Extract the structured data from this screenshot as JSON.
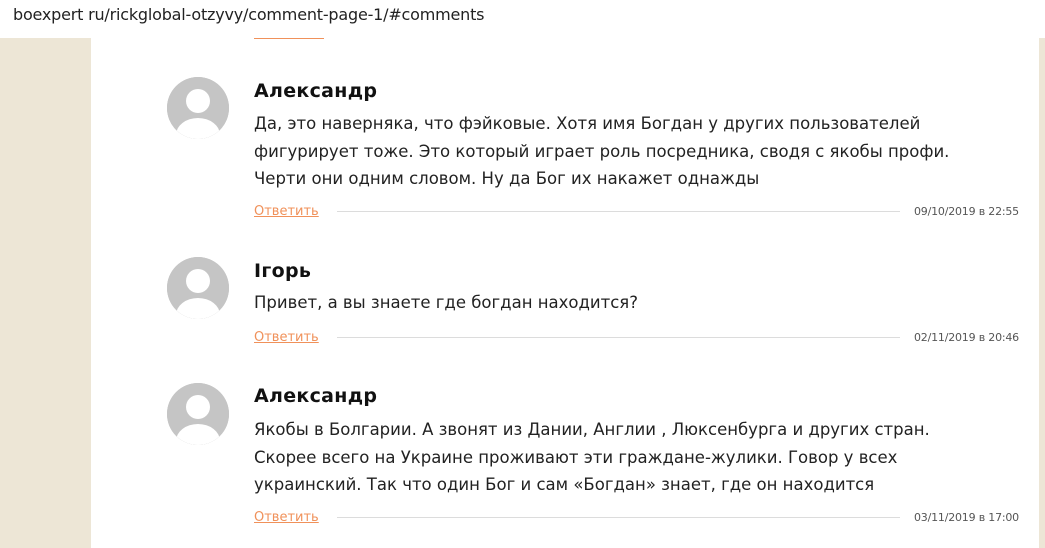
{
  "browser": {
    "url": "boexpert ru/rickglobal-otzyvy/comment-page-1/#comments"
  },
  "comments": [
    {
      "author": "Александр",
      "lines": [
        "Да, это наверняка, что фэйковые. Хотя имя Богдан у других пользователей",
        "фигурирует тоже. Это который играет роль посредника, сводя с якобы профи.",
        "Черти они одним словом. Ну да Бог их накажет однажды"
      ],
      "reply_label": "Ответить",
      "date": "09/10/2019 в 22:55"
    },
    {
      "author": "Iгорь",
      "lines": [
        "Привет, а вы знаете где богдан находится?"
      ],
      "reply_label": "Ответить",
      "date": "02/11/2019 в 20:46"
    },
    {
      "author": "Александр",
      "lines": [
        "Якобы в Болгарии. А звонят из Дании, Англии , Люксенбурга и других стран.",
        "Скорее всего на Украине проживают эти граждане-жулики. Говор у всех",
        "украинский. Так что один Бог и сам «Богдан» знает, где он находится"
      ],
      "reply_label": "Ответить",
      "date": "03/11/2019 в 17:00"
    }
  ],
  "colors": {
    "accent": "#f0915a",
    "sidebar": "#ede6d6",
    "avatar": "#c5c5c5"
  }
}
